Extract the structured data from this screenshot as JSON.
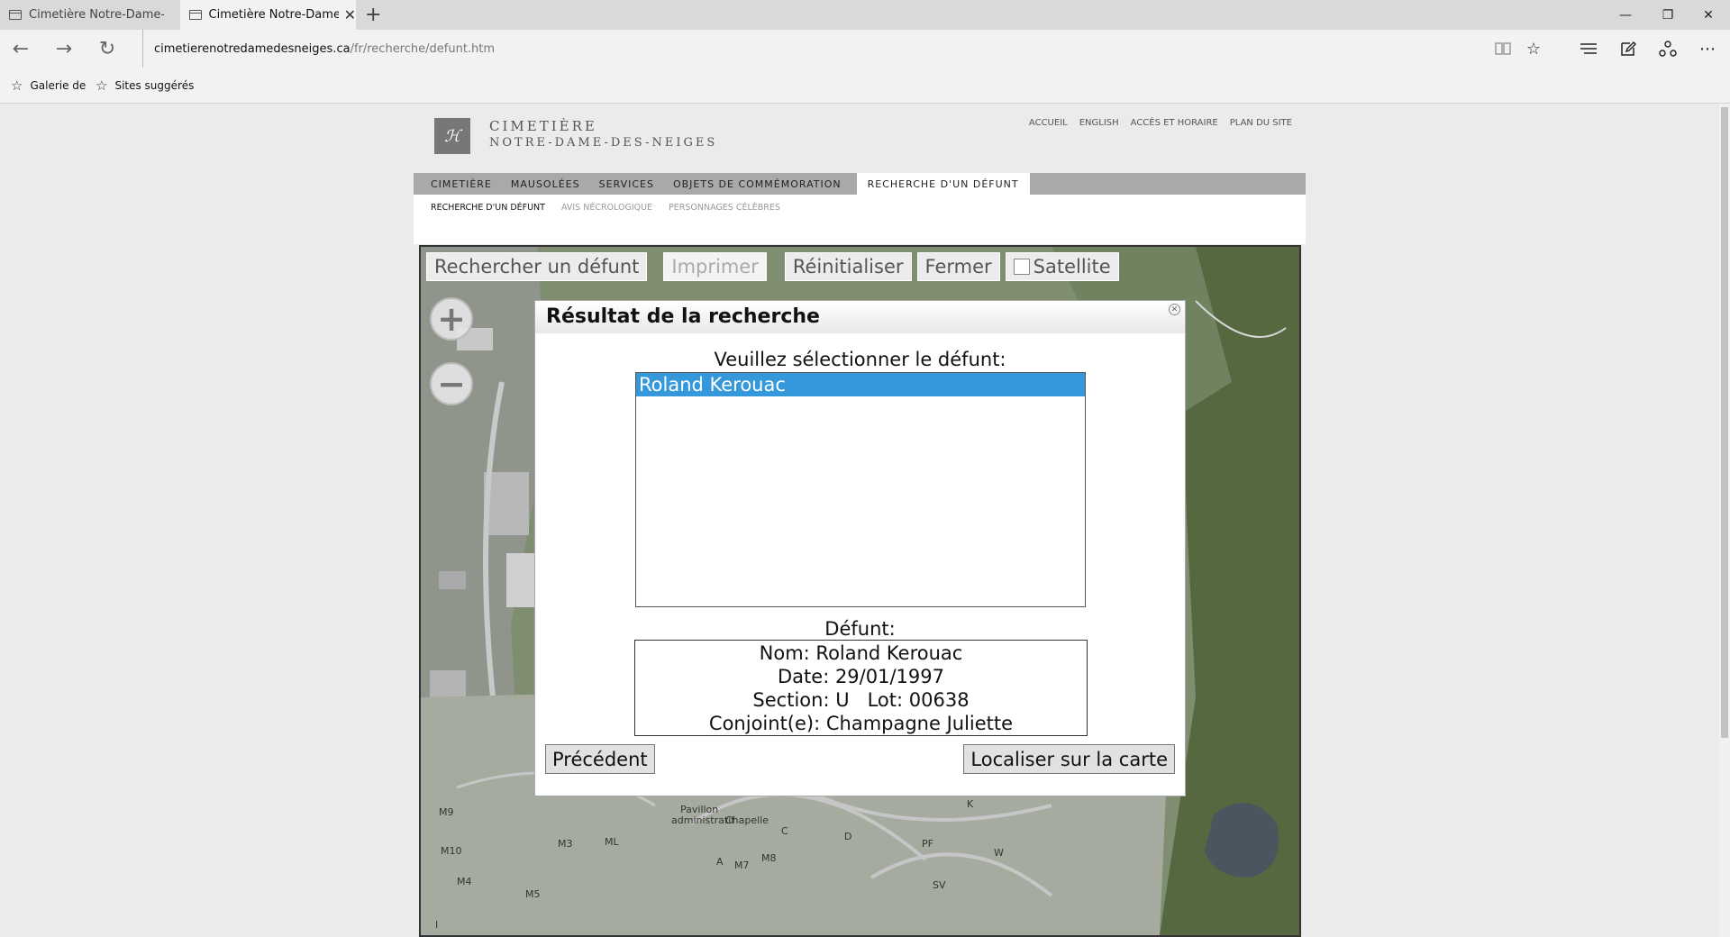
{
  "browser": {
    "tabs": [
      {
        "title": "Cimetière Notre-Dame-des-N"
      },
      {
        "title": "Cimetière Notre-Dame-d",
        "close": "✕"
      }
    ],
    "new_tab": "+",
    "window_controls": {
      "minimize": "—",
      "restore": "❐",
      "close": "✕"
    },
    "url_host": "cimetierenotredamedesneiges.ca",
    "url_path": "/fr/recherche/defunt.htm",
    "favorites": [
      {
        "label": "Galerie de"
      },
      {
        "label": "Sites suggérés"
      }
    ]
  },
  "site": {
    "logo_mark": "ℋ",
    "logo_line1": "CIMETIÈRE",
    "logo_line2": "NOTRE-DAME-DES-NEIGES",
    "top_links": [
      "ACCUEIL",
      "ENGLISH",
      "ACCÈS ET HORAIRE",
      "PLAN DU SITE"
    ],
    "main_nav": [
      "CIMETIÈRE",
      "MAUSOLÉES",
      "SERVICES",
      "OBJETS DE COMMÉMORATION",
      "RECHERCHE D'UN DÉFUNT"
    ],
    "sub_nav": [
      "RECHERCHE D'UN DÉFUNT",
      "AVIS NÉCROLOGIQUE",
      "PERSONNAGES CÉLÈBRES"
    ]
  },
  "map": {
    "toolbar": {
      "search": "Rechercher un défunt",
      "print": "Imprimer",
      "reset": "Réinitialiser",
      "close": "Fermer",
      "satellite": "Satellite"
    },
    "zoom_in": "+",
    "zoom_out": "−",
    "labels": [
      "M9",
      "M10",
      "M4",
      "M5",
      "M3",
      "ML",
      "M7",
      "M8",
      "Pavillon",
      "administratif",
      "Chapelle",
      "C",
      "D",
      "A",
      "K",
      "PF",
      "W",
      "SV",
      "I"
    ]
  },
  "dialog": {
    "title": "Résultat de la recherche",
    "close": "✕",
    "prompt": "Veuillez sélectionner le défunt:",
    "options": [
      "Roland Kerouac"
    ],
    "defunt_label": "Défunt:",
    "details": {
      "name": "Nom: Roland Kerouac",
      "date": "Date: 29/01/1997",
      "section_lot": "Section: U   Lot: 00638",
      "spouse": "Conjoint(e): Champagne Juliette"
    },
    "previous_button": "Précédent",
    "locate_button": "Localiser sur la carte"
  }
}
